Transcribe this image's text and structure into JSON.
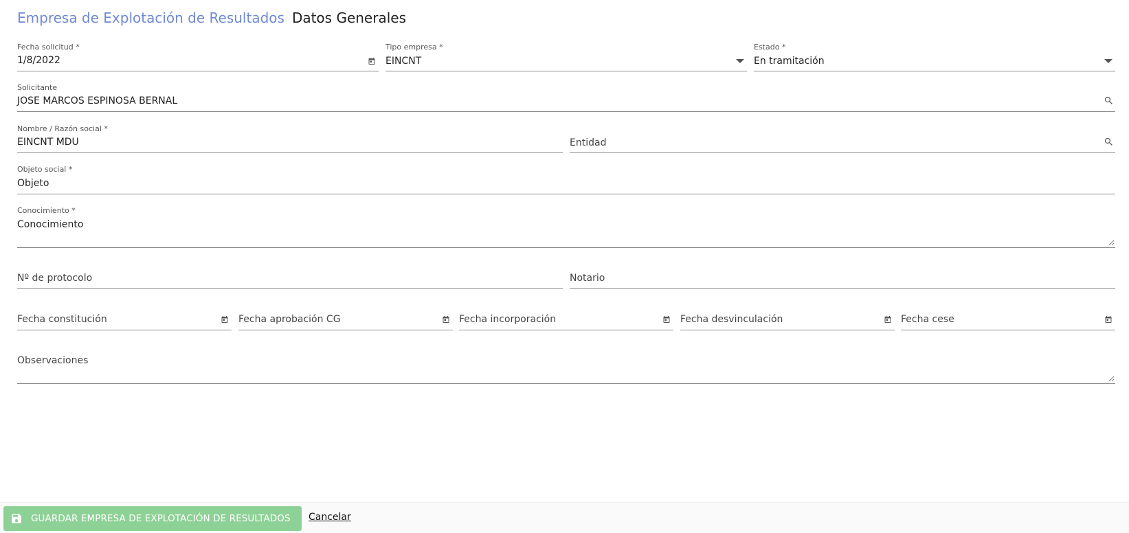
{
  "header": {
    "section": "Empresa de Explotación de Resultados",
    "title": "Datos Generales"
  },
  "form": {
    "fecha_solicitud": {
      "label": "Fecha solicitud *",
      "value": "1/8/2022",
      "icon": "calendar-icon"
    },
    "tipo_empresa": {
      "label": "Tipo empresa *",
      "value": "EINCNT",
      "icon": "dropdown-arrow-icon"
    },
    "estado": {
      "label": "Estado *",
      "value": "En tramitación",
      "icon": "dropdown-arrow-icon"
    },
    "solicitante": {
      "label": "Solicitante",
      "value": "JOSE MARCOS ESPINOSA BERNAL",
      "icon": "search-icon"
    },
    "nombre": {
      "label": "Nombre / Razón social *",
      "value": "EINCNT MDU"
    },
    "entidad": {
      "placeholder": "Entidad",
      "icon": "search-icon"
    },
    "objeto_social": {
      "label": "Objeto social *",
      "value": "Objeto"
    },
    "conocimiento": {
      "label": "Conocimiento *",
      "value": "Conocimiento"
    },
    "protocolo": {
      "placeholder": "Nº de protocolo"
    },
    "notario": {
      "placeholder": "Notario"
    },
    "fecha_constitucion": {
      "placeholder": "Fecha constitución",
      "icon": "calendar-icon"
    },
    "fecha_aprobacion": {
      "placeholder": "Fecha aprobación CG",
      "icon": "calendar-icon"
    },
    "fecha_incorporacion": {
      "placeholder": "Fecha incorporación",
      "icon": "calendar-icon"
    },
    "fecha_desvinculacion": {
      "placeholder": "Fecha desvinculación",
      "icon": "calendar-icon"
    },
    "fecha_cese": {
      "placeholder": "Fecha cese",
      "icon": "calendar-icon"
    },
    "observaciones": {
      "placeholder": "Observaciones"
    }
  },
  "footer": {
    "save_label": "GUARDAR EMPRESA DE EXPLOTACIÓN DE RESULTADOS",
    "save_icon": "save-icon",
    "cancel_label": "Cancelar"
  },
  "colors": {
    "accent": "#7088d6",
    "save_button": "#8ed196",
    "underline": "#8a8a8a"
  }
}
